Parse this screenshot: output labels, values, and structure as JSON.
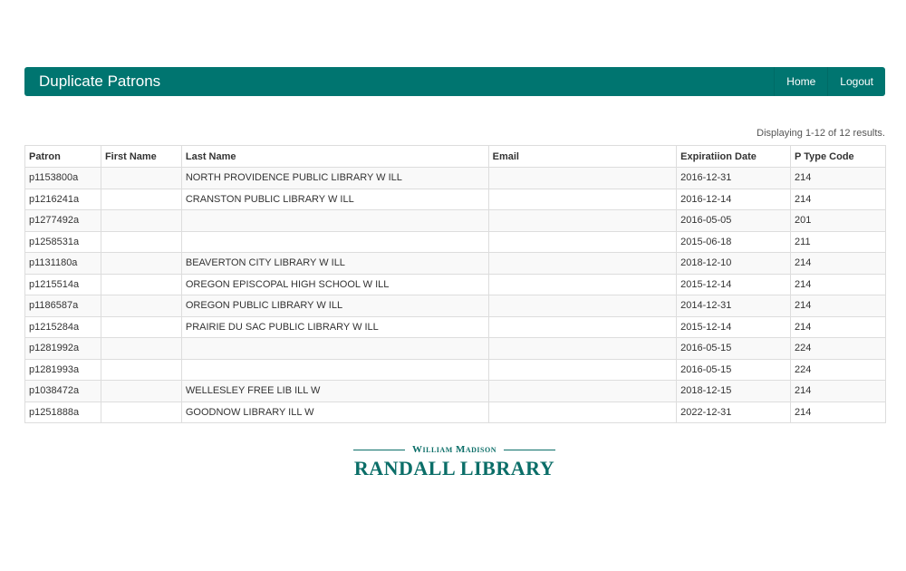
{
  "header": {
    "title": "Duplicate Patrons",
    "nav": [
      "Home",
      "Logout"
    ],
    "color": "#007570"
  },
  "summary": "Displaying 1-12 of 12 results.",
  "table": {
    "columns": [
      "Patron",
      "First Name",
      "Last Name",
      "Email",
      "Expiratiion Date",
      "P Type Code"
    ],
    "rows": [
      [
        "p1153800a",
        "",
        "NORTH PROVIDENCE PUBLIC LIBRARY W ILL",
        "",
        "2016-12-31",
        "214"
      ],
      [
        "p1216241a",
        "",
        "CRANSTON PUBLIC LIBRARY W ILL",
        "",
        "2016-12-14",
        "214"
      ],
      [
        "p1277492a",
        "",
        "",
        "",
        "2016-05-05",
        "201"
      ],
      [
        "p1258531a",
        "",
        "",
        "",
        "2015-06-18",
        "211"
      ],
      [
        "p1131180a",
        "",
        "BEAVERTON CITY LIBRARY W ILL",
        "",
        "2018-12-10",
        "214"
      ],
      [
        "p1215514a",
        "",
        "OREGON EPISCOPAL HIGH SCHOOL W ILL",
        "",
        "2015-12-14",
        "214"
      ],
      [
        "p1186587a",
        "",
        "OREGON PUBLIC LIBRARY W ILL",
        "",
        "2014-12-31",
        "214"
      ],
      [
        "p1215284a",
        "",
        "PRAIRIE DU SAC PUBLIC LIBRARY W ILL",
        "",
        "2015-12-14",
        "214"
      ],
      [
        "p1281992a",
        "",
        "",
        "",
        "2016-05-15",
        "224"
      ],
      [
        "p1281993a",
        "",
        "",
        "",
        "2016-05-15",
        "224"
      ],
      [
        "p1038472a",
        "",
        "WELLESLEY FREE LIB ILL W",
        "",
        "2018-12-15",
        "214"
      ],
      [
        "p1251888a",
        "",
        "GOODNOW LIBRARY ILL W",
        "",
        "2022-12-31",
        "214"
      ]
    ]
  },
  "logo": {
    "line1": "William Madison",
    "line2": "RANDALL LIBRARY"
  }
}
